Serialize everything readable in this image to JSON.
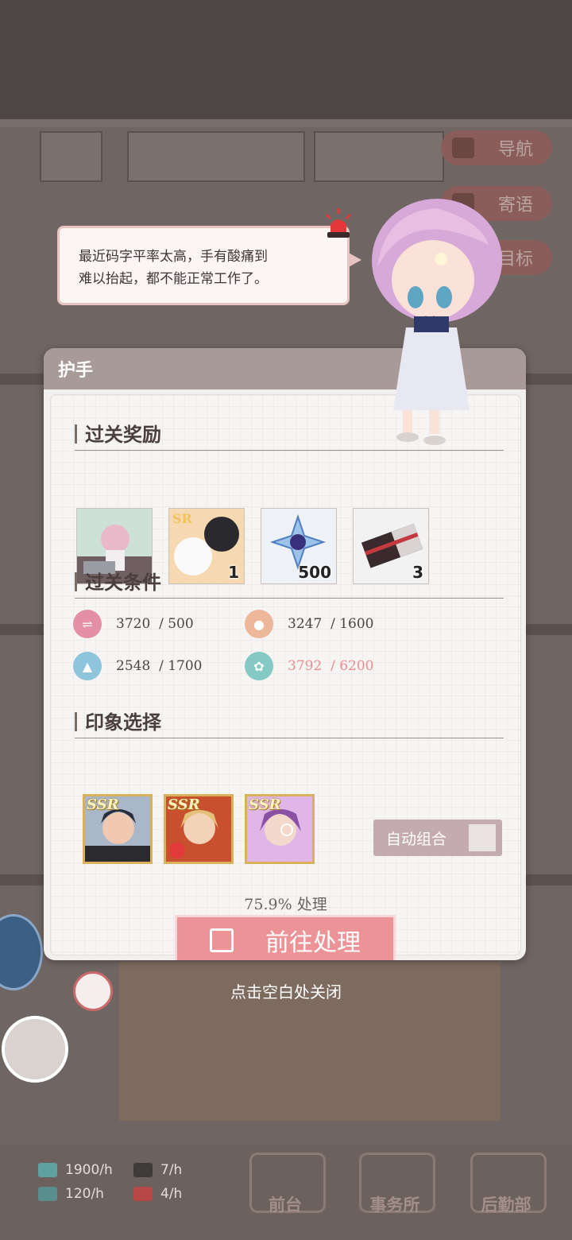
{
  "side_buttons": [
    {
      "label": "导航",
      "icon": "map-icon"
    },
    {
      "label": "寄语",
      "icon": "message-icon"
    },
    {
      "label": "目标",
      "icon": "target-icon"
    }
  ],
  "dialog": {
    "text_line1": "最近码字平率太高，手有酸痛到",
    "text_line2": "难以抬起，都不能正常工作了。"
  },
  "panel": {
    "title": "护手",
    "rewards_title": "过关奖励",
    "rewards": [
      {
        "name": "scene-card",
        "qty": ""
      },
      {
        "name": "sr-cats-card",
        "qty": "1"
      },
      {
        "name": "blue-crystal",
        "qty": "500"
      },
      {
        "name": "ticket",
        "qty": "3"
      }
    ],
    "conditions_title": "过关条件",
    "conditions": [
      {
        "icon": "pen-icon",
        "color": "#e58fa5",
        "current": "3720",
        "required": "/ 500",
        "met": true
      },
      {
        "icon": "person-icon",
        "color": "#edb79a",
        "current": "3247",
        "required": "/ 1600",
        "met": true
      },
      {
        "icon": "graduation-icon",
        "color": "#8ec4dc",
        "current": "2548",
        "required": "/ 1700",
        "met": true
      },
      {
        "icon": "flower-icon",
        "color": "#84c9c4",
        "current": "3792",
        "required": "/ 6200",
        "met": false
      }
    ],
    "impression_title": "印象选择",
    "cards": [
      {
        "rarity": "SSR",
        "name": "dark-hair-card"
      },
      {
        "rarity": "SSR",
        "name": "blond-hair-card"
      },
      {
        "rarity": "SSR",
        "name": "purple-hair-card"
      }
    ],
    "auto_button": "自动组合",
    "progress_text": "75.9% 处理",
    "go_button": "前往处理"
  },
  "close_hint": "点击空白处关闭",
  "stats": [
    {
      "icon": "money-icon",
      "value": "1900/h"
    },
    {
      "icon": "person-stat-icon",
      "value": "7/h"
    },
    {
      "icon": "book-icon",
      "value": "120/h"
    },
    {
      "icon": "gift-icon",
      "value": "4/h"
    }
  ],
  "bottom_nav": [
    "前台",
    "事务所",
    "后勤部"
  ],
  "colors": {
    "accent": "#eb9396",
    "panel_header": "#a89a96",
    "short": "#e88e8e"
  }
}
